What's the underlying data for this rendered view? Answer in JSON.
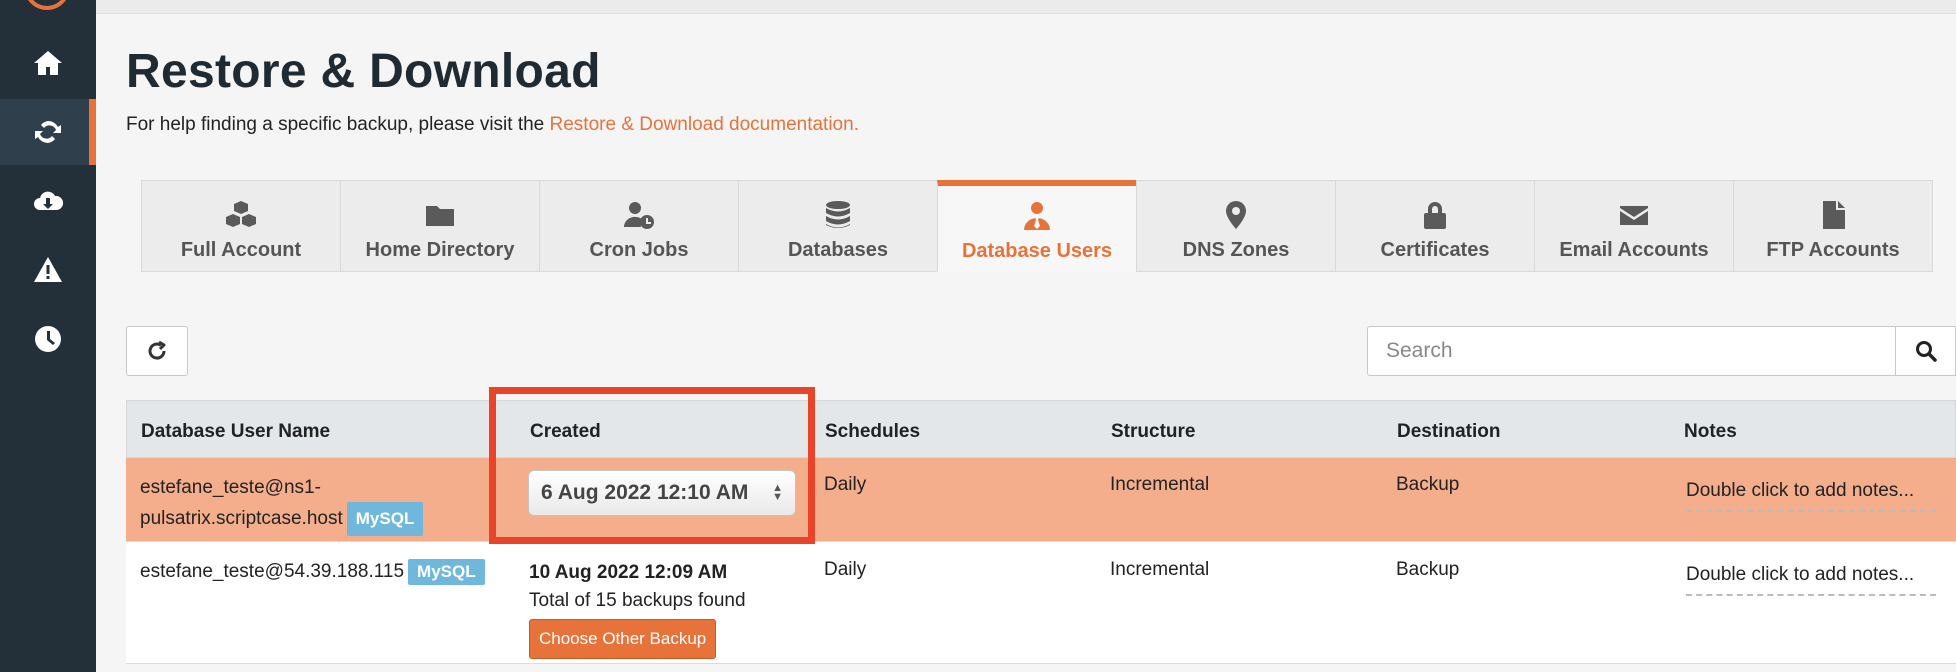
{
  "page": {
    "title": "Restore & Download",
    "help_prefix": "For help finding a specific backup, please visit the",
    "help_link": "Restore & Download documentation."
  },
  "sidebar": {
    "items": [
      {
        "icon": "home-icon"
      },
      {
        "icon": "sync-icon",
        "active": true
      },
      {
        "icon": "cloud-download-icon"
      },
      {
        "icon": "warning-icon"
      },
      {
        "icon": "clock-icon"
      }
    ]
  },
  "tabs": [
    {
      "label": "Full Account",
      "icon": "cubes-icon"
    },
    {
      "label": "Home Directory",
      "icon": "folder-icon"
    },
    {
      "label": "Cron Jobs",
      "icon": "user-clock-icon"
    },
    {
      "label": "Databases",
      "icon": "database-icon"
    },
    {
      "label": "Database Users",
      "icon": "user-tie-icon",
      "active": true
    },
    {
      "label": "DNS Zones",
      "icon": "map-marker-icon"
    },
    {
      "label": "Certificates",
      "icon": "lock-icon"
    },
    {
      "label": "Email Accounts",
      "icon": "envelope-icon"
    },
    {
      "label": "FTP Accounts",
      "icon": "file-icon"
    }
  ],
  "search": {
    "placeholder": "Search"
  },
  "table": {
    "headers": [
      "Database User Name",
      "Created",
      "Schedules",
      "Structure",
      "Destination",
      "Notes"
    ],
    "rows": [
      {
        "user_line1": "estefane_teste@ns1-",
        "user_line2": "pulsatrix.scriptcase.host",
        "badge": "MySQL",
        "created_select": "6 Aug 2022 12:10 AM",
        "schedule": "Daily",
        "structure": "Incremental",
        "destination": "Backup",
        "notes": "Double click to add notes..."
      },
      {
        "user": "estefane_teste@54.39.188.115",
        "badge": "MySQL",
        "created": "10 Aug 2022 12:09 AM",
        "backups_found": "Total of 15 backups found",
        "choose_label": "Choose Other Backup",
        "schedule": "Daily",
        "structure": "Incremental",
        "destination": "Backup",
        "notes": "Double click to add notes..."
      }
    ]
  },
  "colors": {
    "accent": "#e8733a",
    "sidebar": "#243039",
    "selected_row": "#f4ae8c",
    "highlight": "#e8442a",
    "badge": "#6fb8dc"
  }
}
